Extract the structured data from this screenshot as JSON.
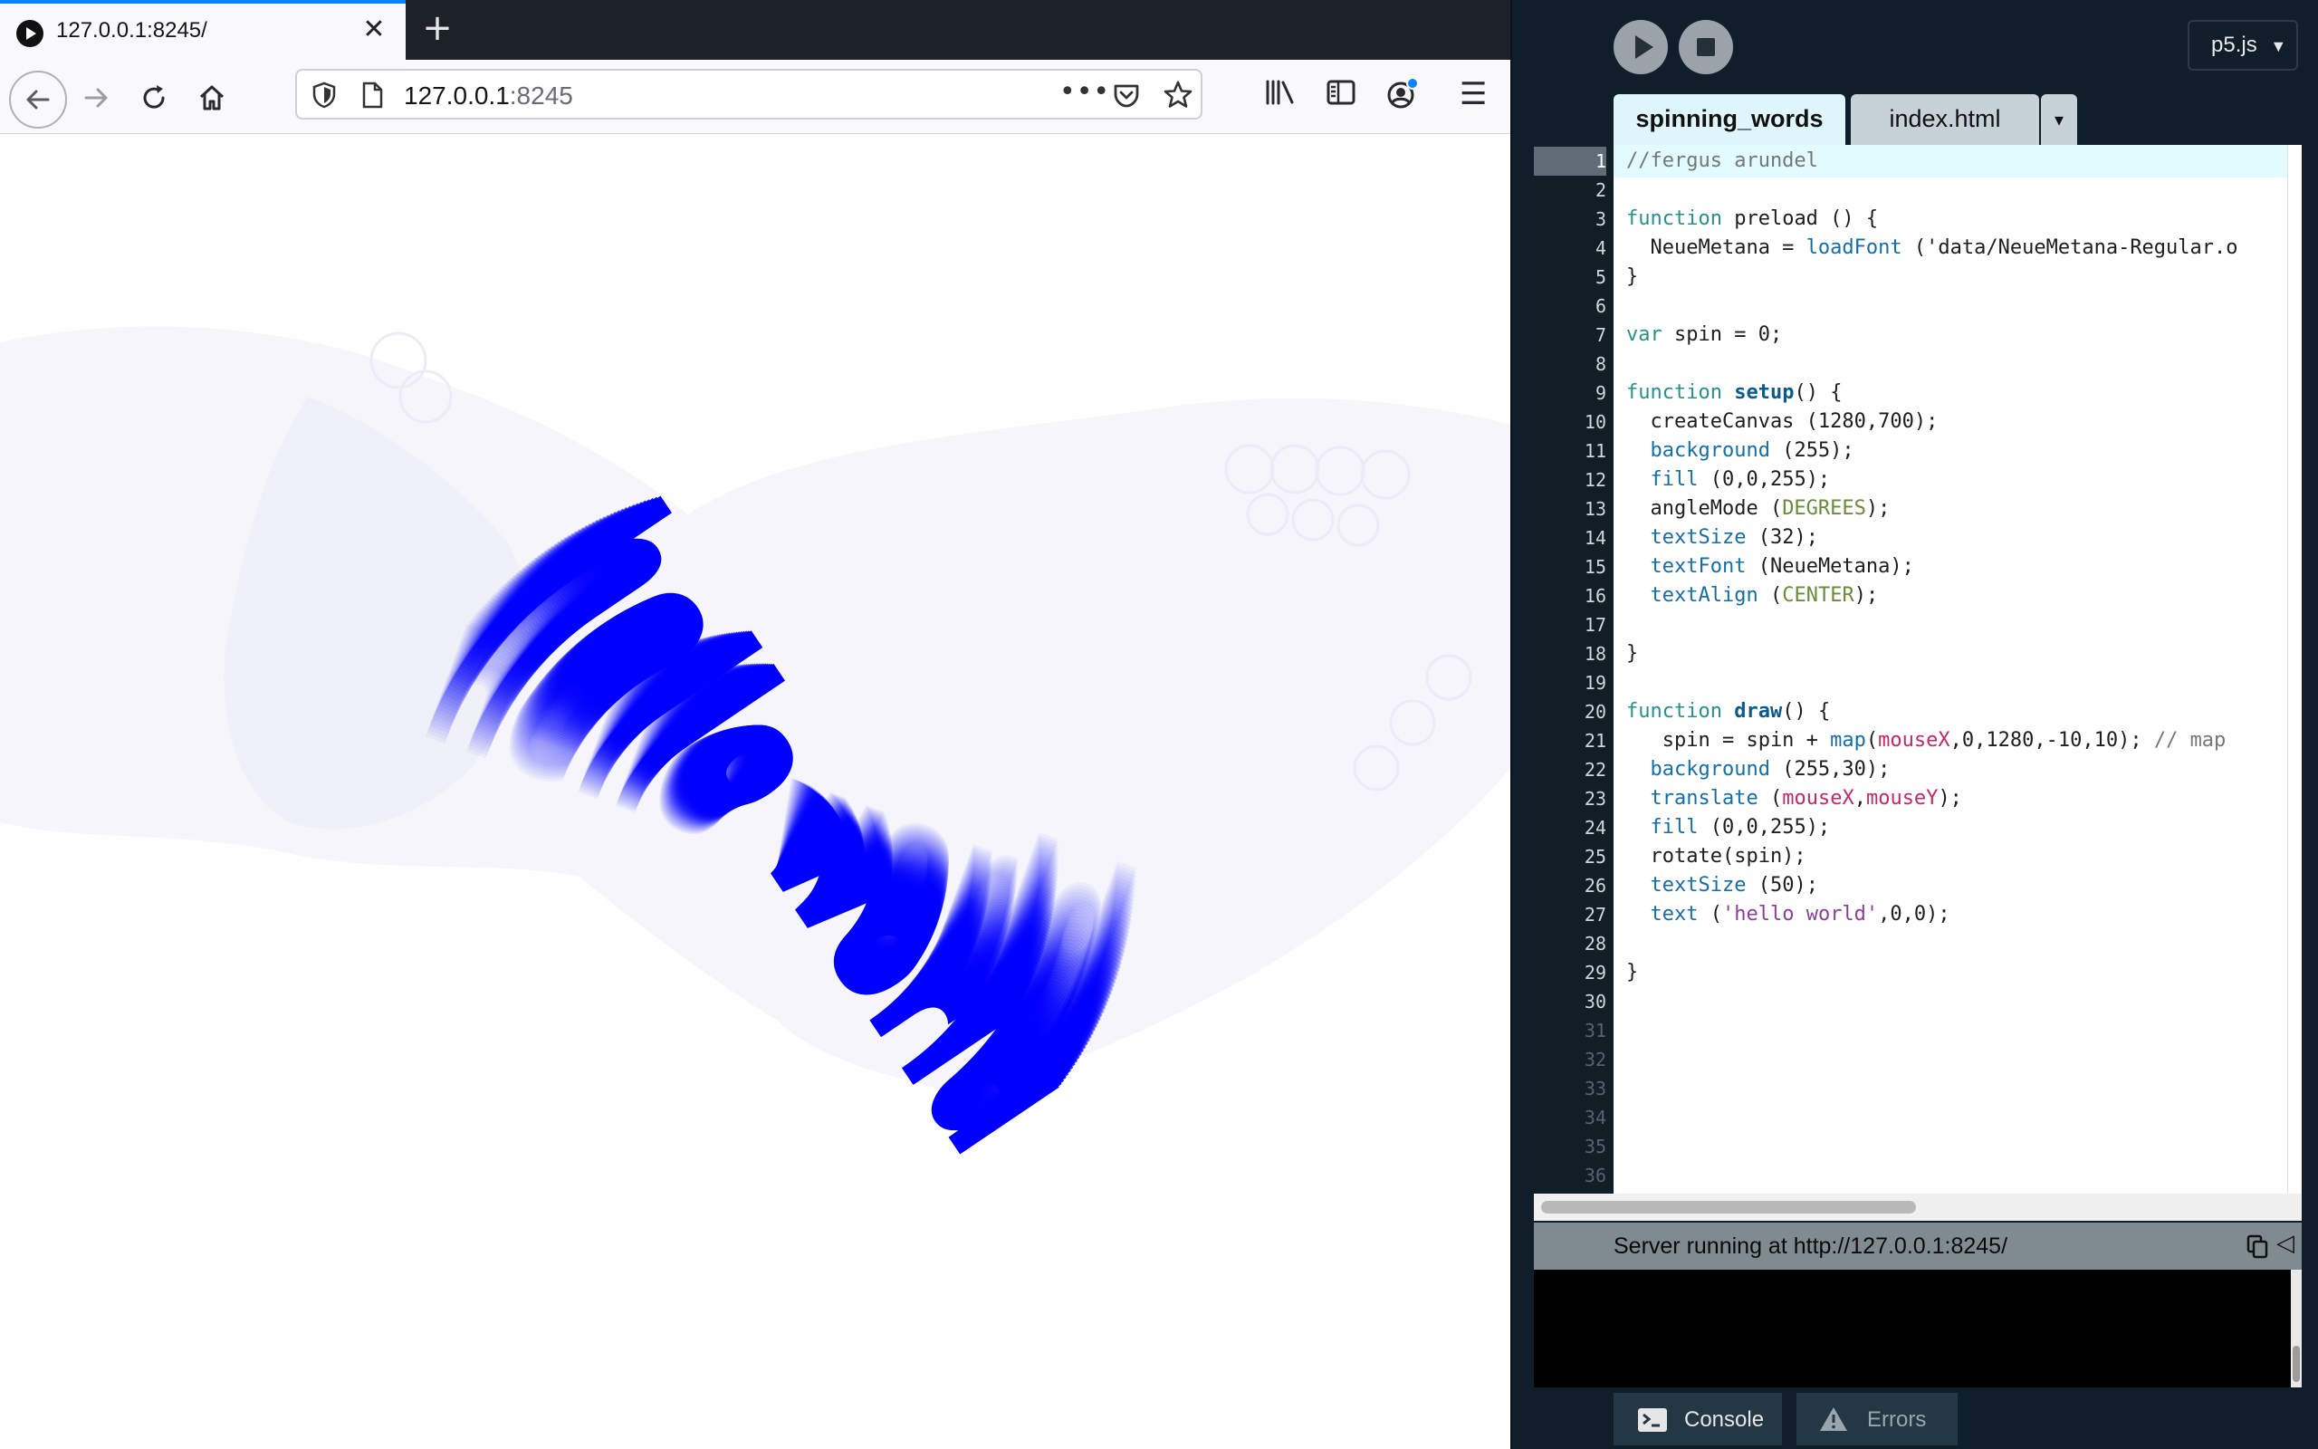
{
  "browser": {
    "tab_title": "127.0.0.1:8245/",
    "tab_close": "✕",
    "new_tab": "+",
    "url_host": "127.0.0.1",
    "url_port": ":8245",
    "more": "•••",
    "menu": "☰"
  },
  "sketch": {
    "text": "hello world",
    "text_color": "#0000ff",
    "background": "#ffffff"
  },
  "editor": {
    "library_select": "p5.js",
    "library_caret": "▼",
    "tabs": [
      {
        "label": "spinning_words",
        "active": true
      },
      {
        "label": "index.html",
        "active": false
      }
    ],
    "tabs_dropdown": "▾",
    "line_numbers": [
      "1",
      "2",
      "3",
      "4",
      "5",
      "6",
      "7",
      "8",
      "9",
      "10",
      "11",
      "12",
      "13",
      "14",
      "15",
      "16",
      "17",
      "18",
      "19",
      "20",
      "21",
      "22",
      "23",
      "24",
      "25",
      "26",
      "27",
      "28",
      "29",
      "30",
      "31",
      "32",
      "33",
      "34",
      "35",
      "36"
    ],
    "code_lines": [
      "//fergus arundel",
      "",
      "function preload () {",
      "  NeueMetana = loadFont ('data/NeueMetana-Regular.o",
      "}",
      "",
      "var spin = 0;",
      "",
      "function setup() {",
      "  createCanvas (1280,700);",
      "  background (255);",
      "  fill (0,0,255);",
      "  angleMode (DEGREES);",
      "  textSize (32);",
      "  textFont (NeueMetana);",
      "  textAlign (CENTER);",
      "",
      "}",
      "",
      "function draw() {",
      "   spin = spin + map(mouseX,0,1280,-10,10); // map",
      "  background (255,30);",
      "  translate (mouseX,mouseY);",
      "  fill (0,0,255);",
      "  rotate(spin);",
      "  textSize (50);",
      "  text ('hello world',0,0);",
      "",
      "}"
    ]
  },
  "console": {
    "status": "Server running at http://127.0.0.1:8245/",
    "collapse": "◁",
    "console_tab": "Console",
    "errors_tab": "Errors"
  },
  "colors": {
    "browser_accent": "#0a84ff",
    "editor_bg": "#0f1e2a",
    "active_tab": "#dff6ff",
    "sketch_blue": "#0000ff"
  }
}
